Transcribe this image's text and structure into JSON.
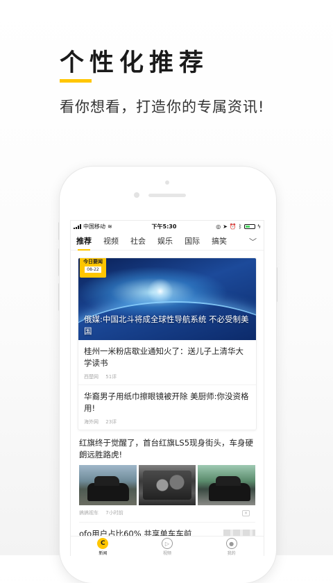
{
  "promo": {
    "title": "个性化推荐",
    "subtitle": "看你想看，打造你的专属资讯!"
  },
  "status_bar": {
    "carrier": "中国移动",
    "time": "下午5:30"
  },
  "tabs": [
    "推荐",
    "视频",
    "社会",
    "娱乐",
    "国际",
    "搞笑"
  ],
  "featured": {
    "badge_title": "今日要闻",
    "badge_date": "08-22",
    "hero_title": "俄媒:中国北斗将成全球性导航系统 不必受制美国",
    "items": [
      {
        "title": "桂州一米粉店歇业通知火了：送儿子上清华大学读书",
        "source": "西楚网",
        "comments": "51评"
      },
      {
        "title": "华裔男子用纸巾擦眼镜被开除 美厨师:你没资格用!",
        "source": "海外网",
        "comments": "23评"
      }
    ]
  },
  "article": {
    "title": "红旗终于觉醒了，首台红旗LS5现身街头，车身硬朗远胜路虎!",
    "source": "搞搞视车",
    "time": "7小时前"
  },
  "article2": {
    "title": "ofo用户占比60% 共享单车车前"
  },
  "bottom_nav": [
    {
      "label": "新闻"
    },
    {
      "label": "视频"
    },
    {
      "label": "我的"
    }
  ],
  "colors": {
    "accent": "#ffc600",
    "battery": "#4cd964"
  }
}
